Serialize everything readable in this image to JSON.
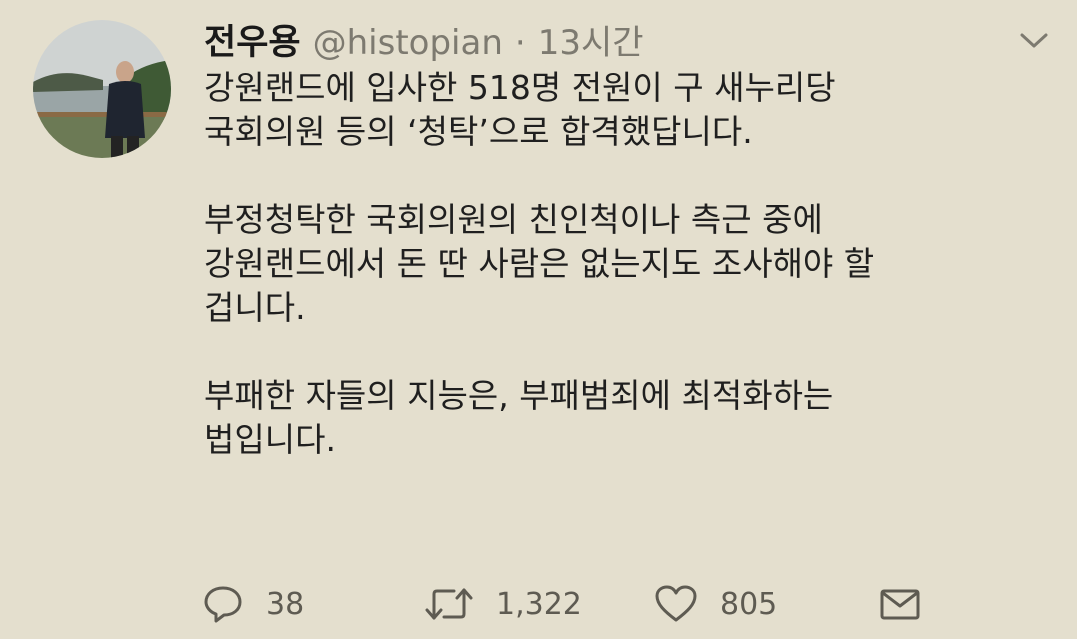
{
  "author": {
    "name": "전우용",
    "handle": "@histopian",
    "separator": "·",
    "time": "13시간"
  },
  "tweet": {
    "paragraphs": [
      [
        "강원랜드에 입사한 518명 전원이 구 새누리당",
        "국회의원 등의 ‘청탁’으로 합격했답니다."
      ],
      [
        "부정청탁한 국회의원의 친인척이나 측근 중에",
        "강원랜드에서 돈 딴 사람은 없는지도 조사해야 할",
        "겁니다."
      ],
      [
        "부패한 자들의 지능은, 부패범죄에 최적화하는",
        "법입니다."
      ]
    ]
  },
  "actions": {
    "reply": {
      "icon": "reply-icon",
      "count": "38"
    },
    "retweet": {
      "icon": "retweet-icon",
      "count": "1,322"
    },
    "like": {
      "icon": "heart-icon",
      "count": "805"
    },
    "dm": {
      "icon": "envelope-icon"
    }
  },
  "colors": {
    "background": "#e4dfce",
    "text": "#1f1f1f",
    "muted": "#7d7a70",
    "icon": "#5e5b52"
  }
}
